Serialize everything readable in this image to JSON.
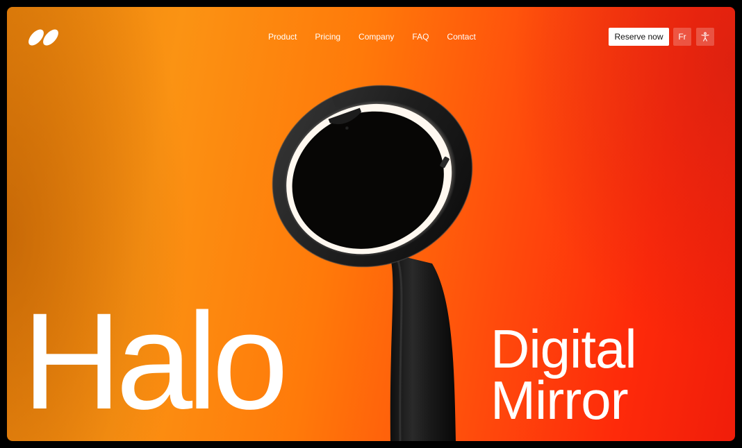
{
  "brand": {
    "logo_icon": "brand-logo-icon"
  },
  "nav": {
    "items": [
      {
        "label": "Product"
      },
      {
        "label": "Pricing"
      },
      {
        "label": "Company"
      },
      {
        "label": "FAQ"
      },
      {
        "label": "Contact"
      }
    ]
  },
  "header_actions": {
    "reserve_label": "Reserve now",
    "language_label": "Fr",
    "accessibility_icon": "accessibility-icon"
  },
  "hero": {
    "title": "Halo",
    "subtitle_line1": "Digital",
    "subtitle_line2": "Mirror",
    "product_image": "halo-mirror-image"
  },
  "colors": {
    "background_start": "#fb9313",
    "background_end": "#fe2a0a",
    "text": "#ffffff",
    "product_body": "#1c1c1c",
    "product_ring_light": "#fff8f0"
  }
}
